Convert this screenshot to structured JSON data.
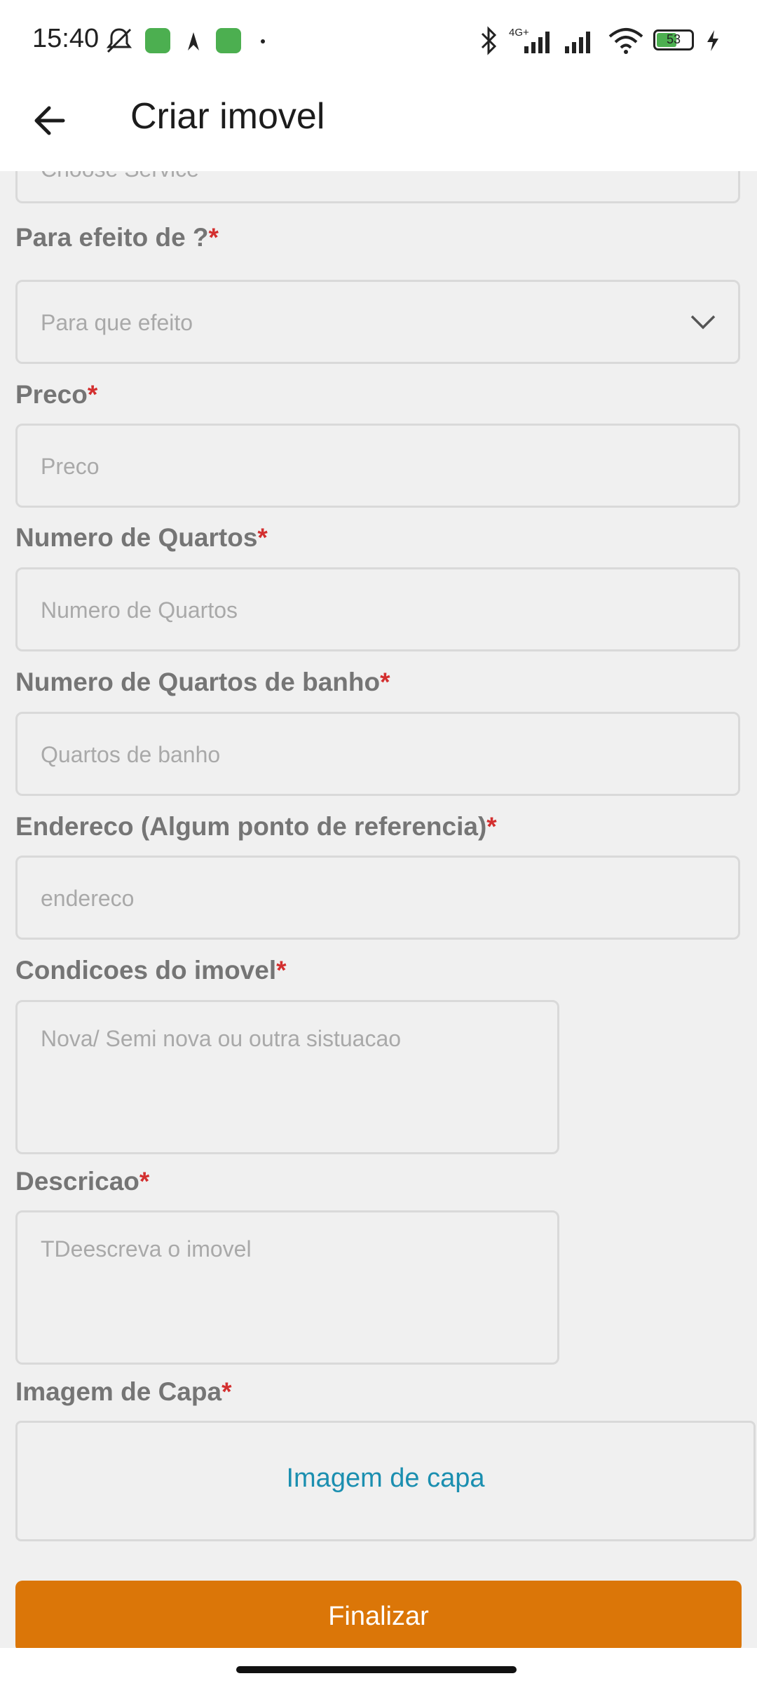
{
  "status_bar": {
    "time": "15:40",
    "network_label": "4G+",
    "battery_level": "53",
    "icons": [
      "mute-icon",
      "app-notification-icon",
      "app-notification-icon",
      "bluetooth-icon",
      "signal-icon",
      "signal-icon",
      "wifi-icon",
      "battery-icon",
      "charging-icon"
    ]
  },
  "app_bar": {
    "title": "Criar imovel",
    "back_icon": "arrow-left-icon"
  },
  "form": {
    "partial_field_placeholder": "Choose Service",
    "purpose": {
      "label": "Para efeito de ?",
      "placeholder": "Para que efeito"
    },
    "price": {
      "label": "Preco",
      "placeholder": "Preco"
    },
    "rooms": {
      "label": "Numero de Quartos",
      "placeholder": "Numero de Quartos"
    },
    "bathrooms": {
      "label": "Numero de Quartos de banho",
      "placeholder": "Quartos de banho"
    },
    "address": {
      "label": "Endereco (Algum ponto de referencia)",
      "placeholder": "endereco"
    },
    "condition": {
      "label": "Condicoes do imovel",
      "placeholder": "Nova/ Semi nova ou outra sistuacao"
    },
    "description": {
      "label": "Descricao",
      "placeholder": "TDeescreva o imovel"
    },
    "cover_image": {
      "label": "Imagem de Capa",
      "button": "Imagem de capa"
    },
    "required_mark": "*",
    "submit_label": "Finalizar"
  },
  "colors": {
    "accent": "#db7608",
    "required": "#d32f2f",
    "link": "#1b8fb0",
    "background": "#f0f0f0"
  }
}
